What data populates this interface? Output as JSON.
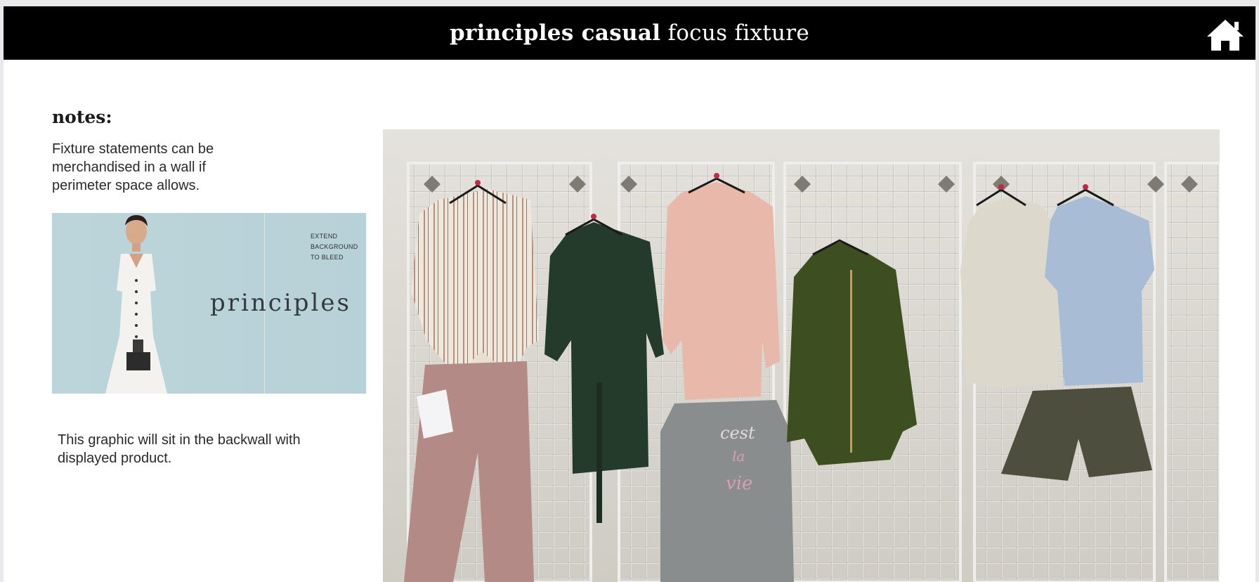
{
  "header": {
    "title_bold": "principles casual",
    "title_light": "focus fixture",
    "home_icon": "home-icon"
  },
  "notes": {
    "heading": "notes:",
    "body": "Fixture statements can be merchandised in a wall if perimeter space allows."
  },
  "graphic": {
    "brand": "principles",
    "extend_line1": "EXTEND",
    "extend_line2": "BACKGROUND",
    "extend_line3": "TO BLEED"
  },
  "caption": "This graphic will sit in the backwall with displayed product.",
  "photo": {
    "tee_line1": "cest",
    "tee_line2": "la",
    "tee_line3": "vie"
  },
  "colors": {
    "header_bg": "#000000",
    "graphic_bg": "#b9d3d9"
  }
}
